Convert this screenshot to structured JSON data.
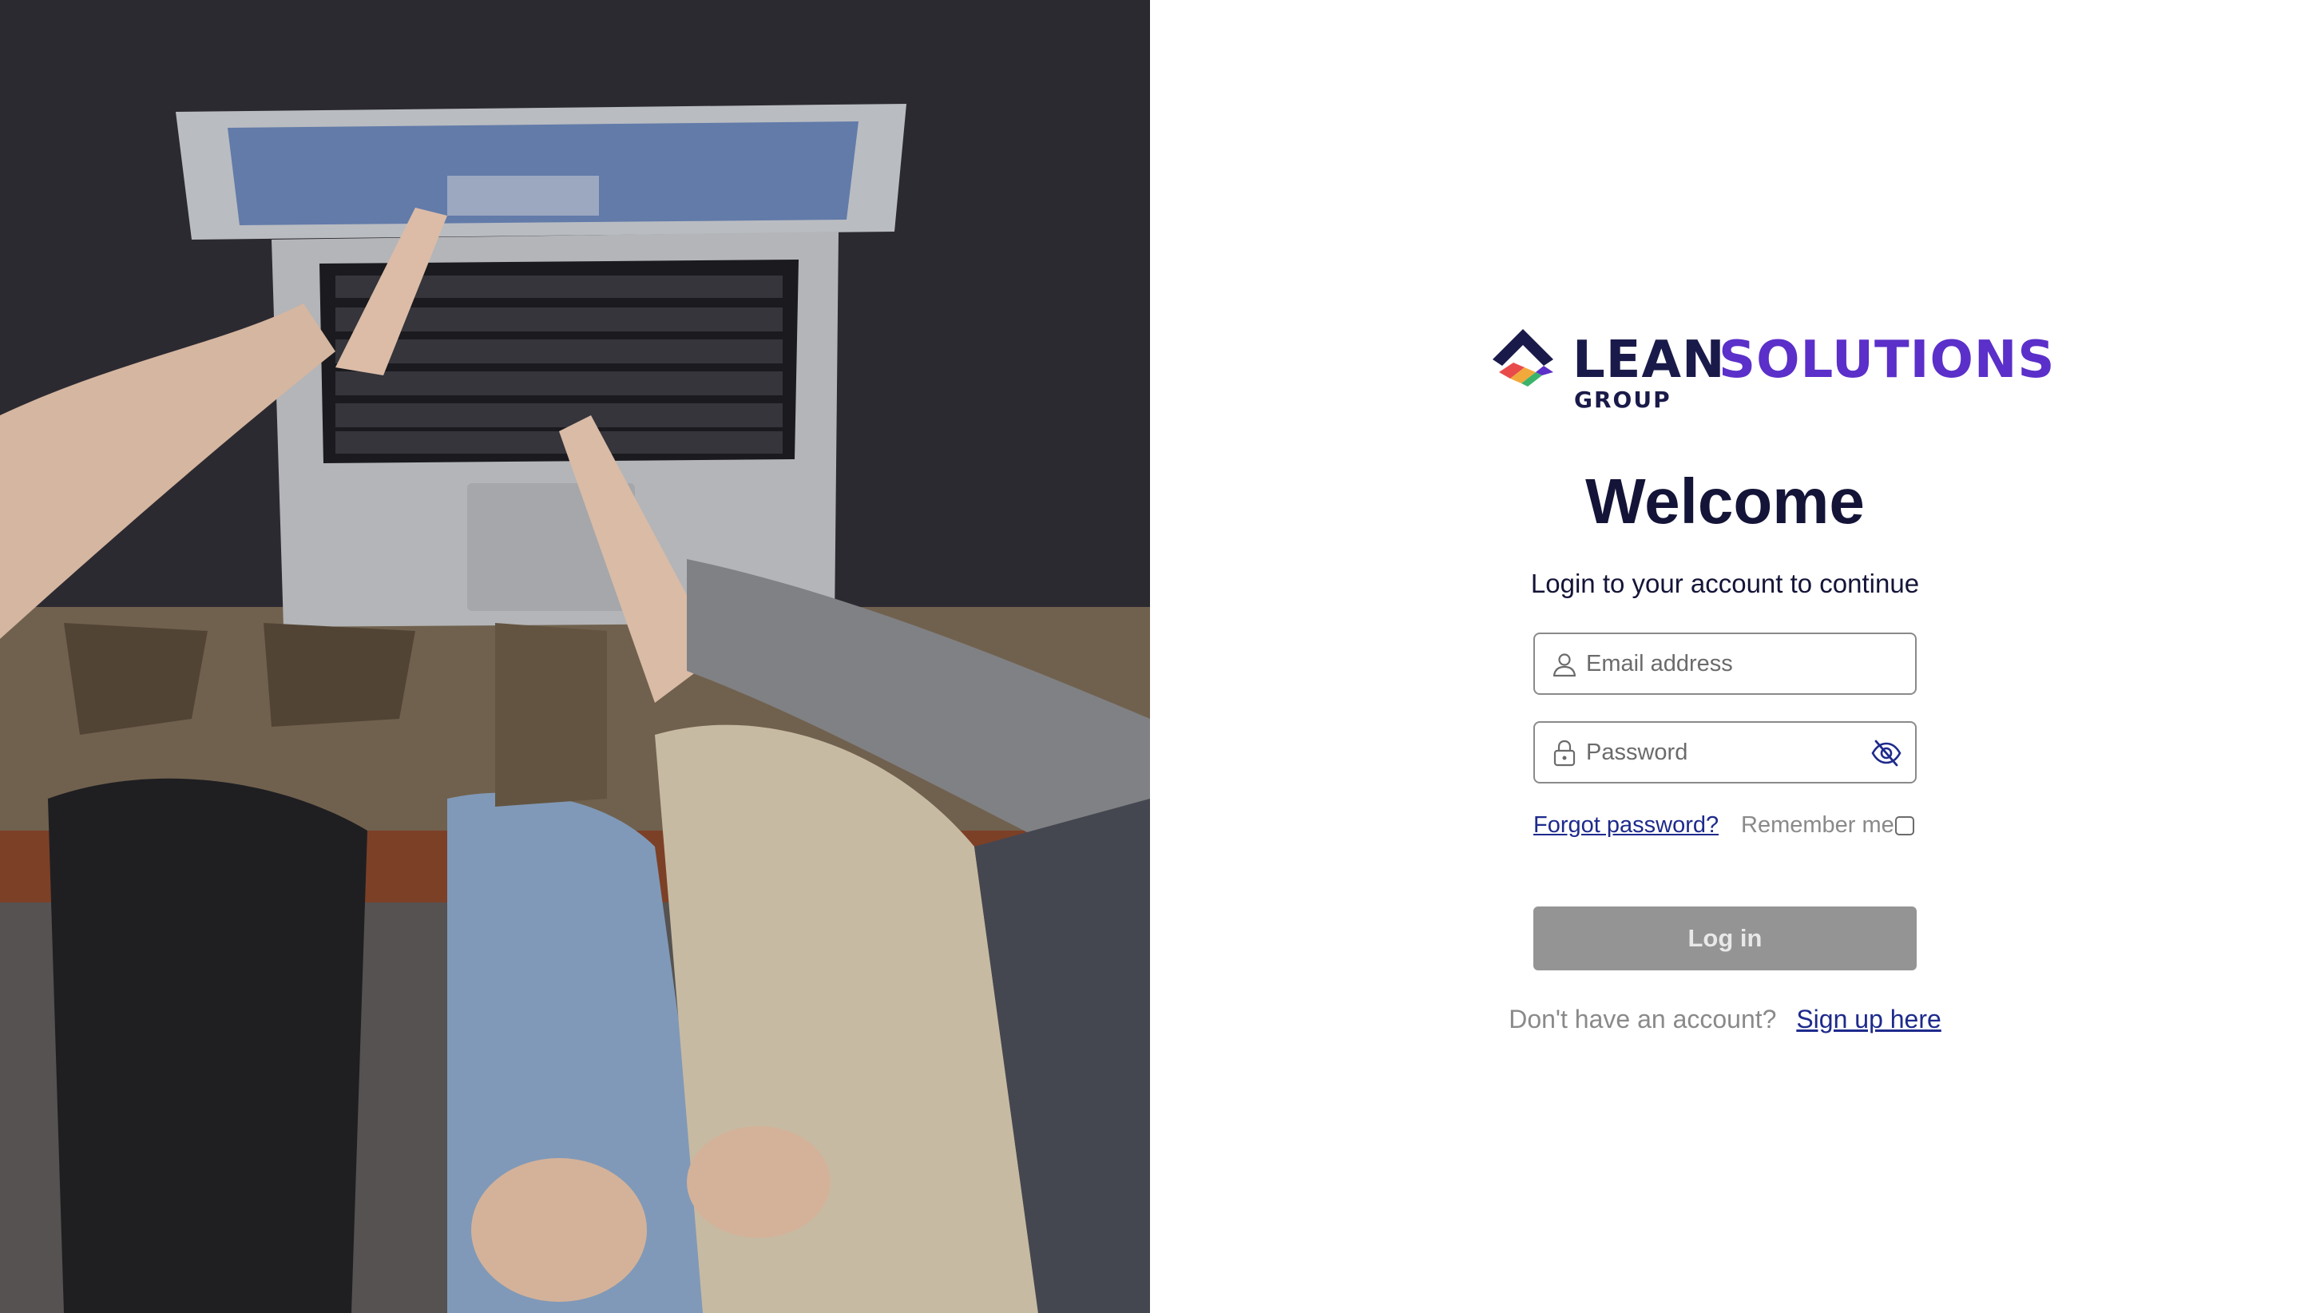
{
  "photo": {
    "icon": "people-using-laptop-photo"
  },
  "brand": {
    "logo_icon": "house-roof-logo-icon",
    "word_lean": "LEAN",
    "word_solutions": "SOLUTIONS",
    "word_group": "GROUP",
    "color_dark": "#1a1a4a",
    "color_accent": "#5b2fc9"
  },
  "login": {
    "title": "Welcome",
    "subtitle": "Login to your account to continue",
    "email_placeholder": "Email address",
    "email_value": "",
    "email_icon": "user-icon",
    "password_placeholder": "Password",
    "password_value": "",
    "password_icon": "lock-icon",
    "password_toggle_icon": "eye-off-icon",
    "forgot_label": "Forgot password?",
    "remember_label": "Remember me",
    "remember_checked": false,
    "submit_label": "Log in",
    "submit_color": "#949494",
    "signup_prompt": "Don't have an account?",
    "signup_link": "Sign up here",
    "link_color": "#1e2a8c"
  }
}
